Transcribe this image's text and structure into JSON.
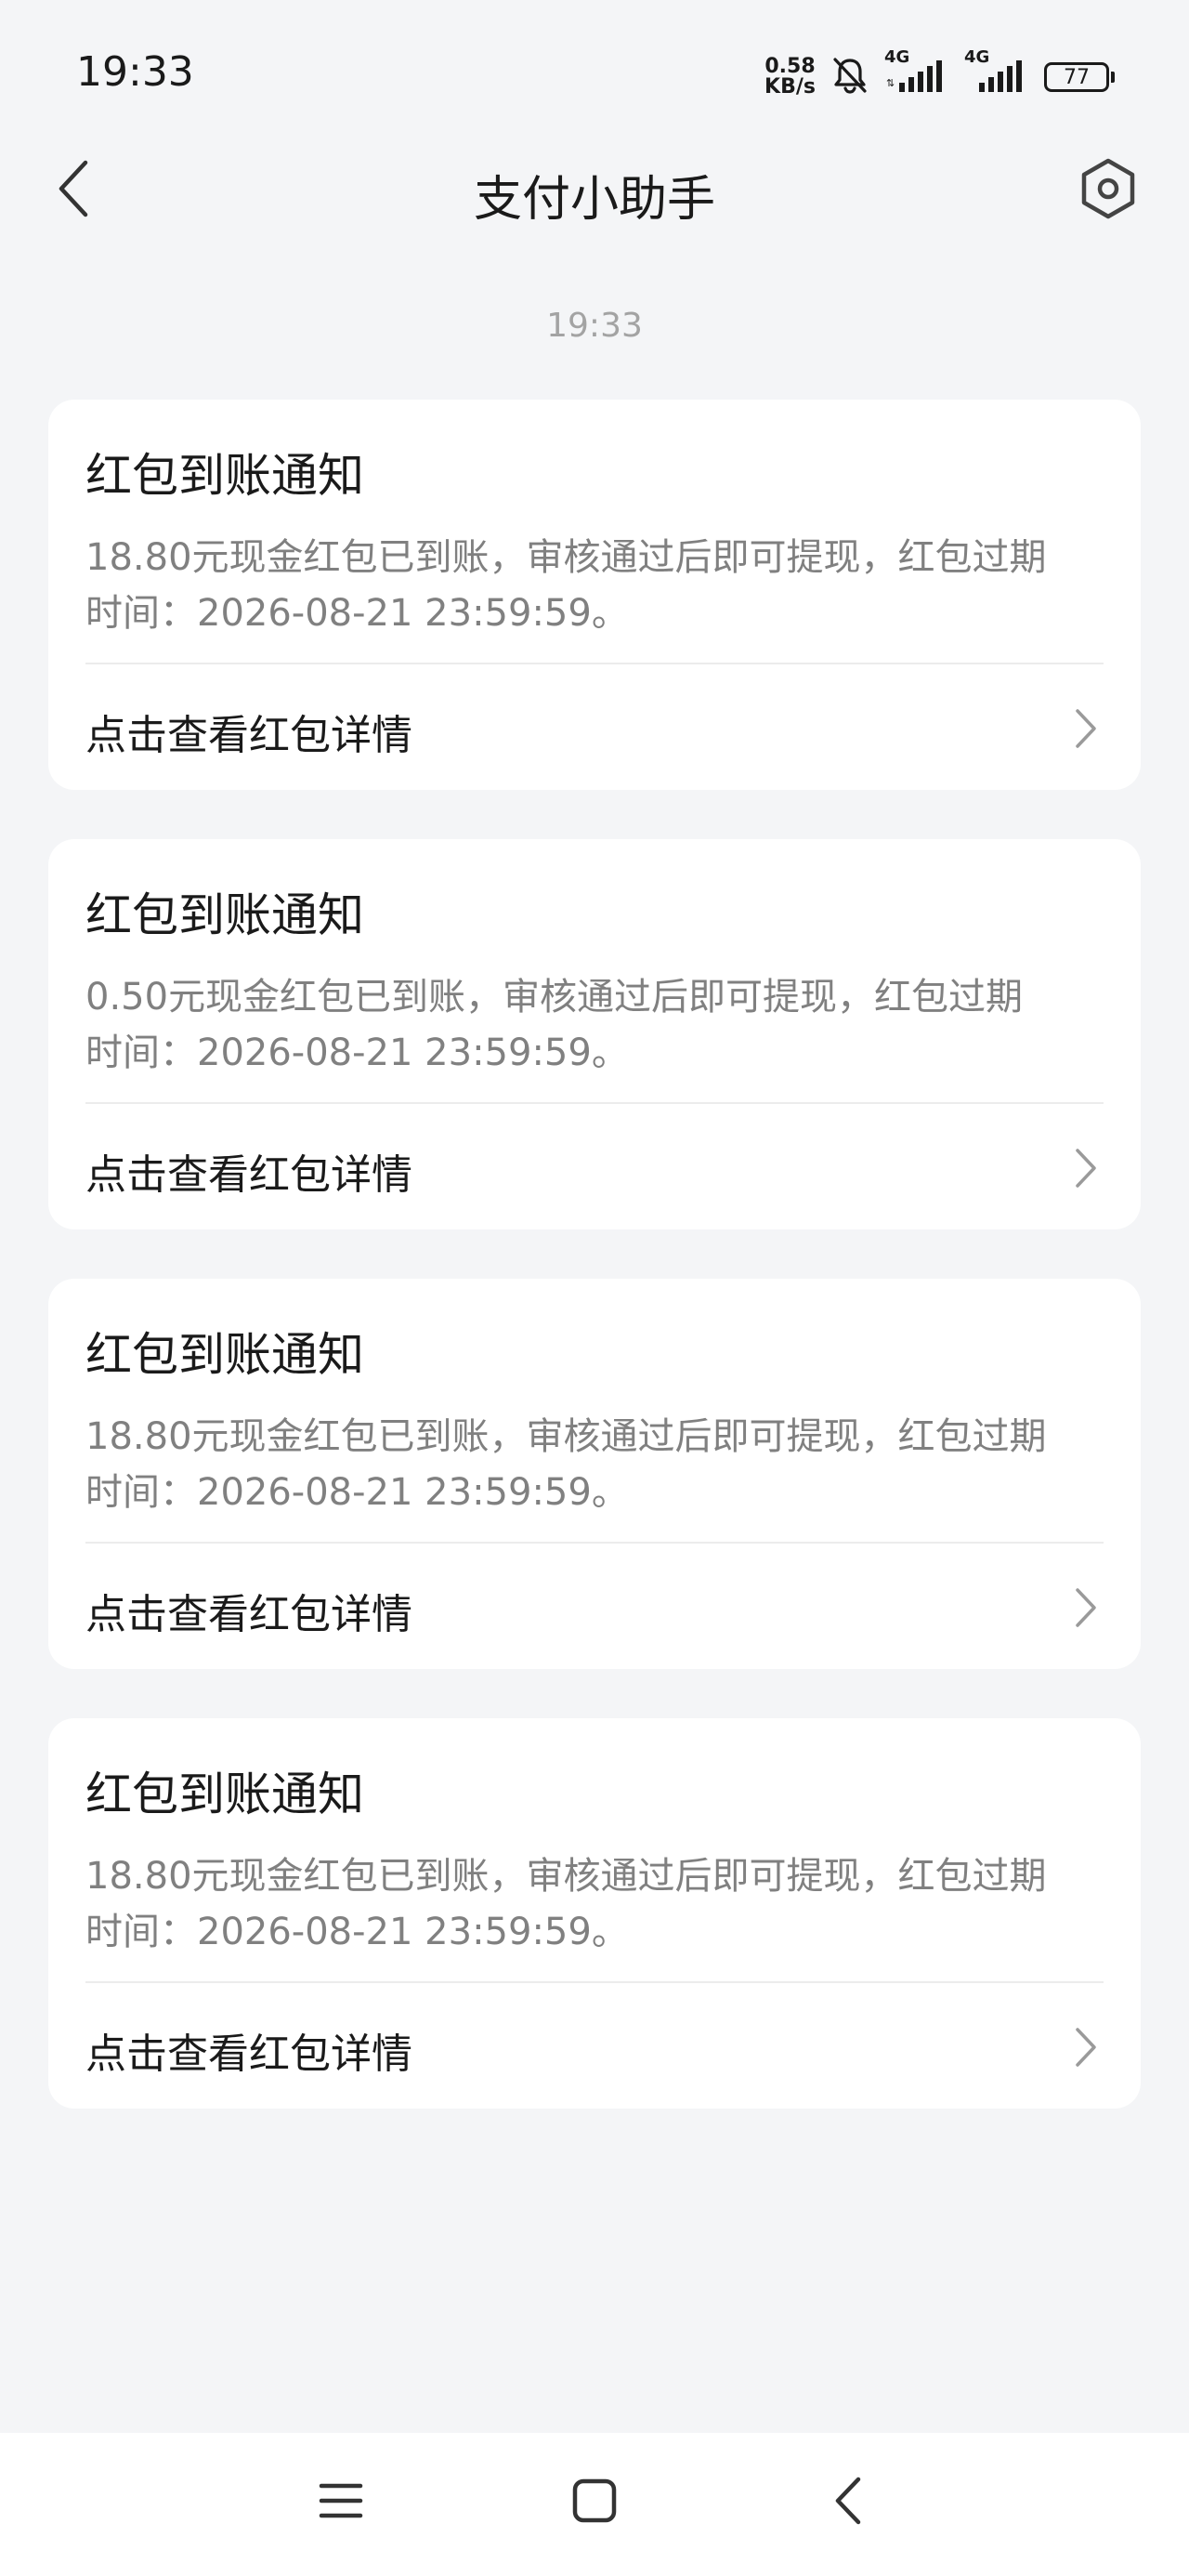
{
  "status_bar": {
    "time": "19:33",
    "net_speed_value": "0.58",
    "net_speed_unit": "KB/s",
    "sim1_label": "4G",
    "sim2_label": "4G",
    "battery_level": "77"
  },
  "header": {
    "title": "支付小助手"
  },
  "timestamp": "19:33",
  "cards": [
    {
      "title": "红包到账通知",
      "body_line1": "18.80元现金红包已到账，审核通过后即可提现，红包过期",
      "body_line2": "时间：2026-08-21 23:59:59。",
      "link_label": "点击查看红包详情"
    },
    {
      "title": "红包到账通知",
      "body_line1": "0.50元现金红包已到账，审核通过后即可提现，红包过期",
      "body_line2": "时间：2026-08-21 23:59:59。",
      "link_label": "点击查看红包详情"
    },
    {
      "title": "红包到账通知",
      "body_line1": "18.80元现金红包已到账，审核通过后即可提现，红包过期",
      "body_line2": "时间：2026-08-21 23:59:59。",
      "link_label": "点击查看红包详情"
    },
    {
      "title": "红包到账通知",
      "body_line1": "18.80元现金红包已到账，审核通过后即可提现，红包过期",
      "body_line2": "时间：2026-08-21 23:59:59。",
      "link_label": "点击查看红包详情"
    }
  ],
  "icons": {
    "mute": "bell-off-icon",
    "signal": "signal-bars-icon",
    "back": "chevron-left-icon",
    "settings": "hexagon-settings-icon",
    "link": "chevron-right-icon",
    "menu": "menu-icon",
    "home": "home-square-icon"
  },
  "colors": {
    "background": "#f4f5f7",
    "card": "#ffffff",
    "body_text": "#808080",
    "timestamp": "#a3a3a3"
  }
}
